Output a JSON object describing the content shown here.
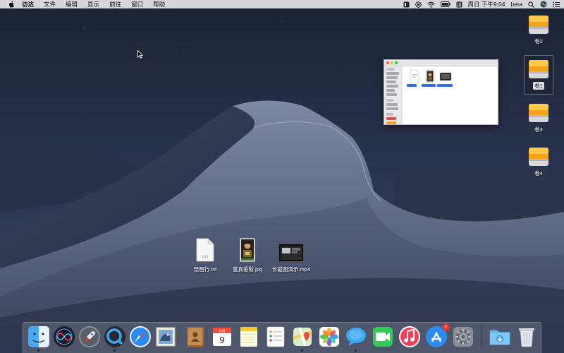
{
  "menubar": {
    "app_name": "访达",
    "items": [
      "文件",
      "编辑",
      "显示",
      "前往",
      "窗口",
      "帮助"
    ],
    "clock": "周日 下午9:04",
    "user": "beta"
  },
  "drives": [
    {
      "label": "卷2",
      "selected": false
    },
    {
      "label": "卷1",
      "selected": true
    },
    {
      "label": "卷3",
      "selected": false
    },
    {
      "label": "卷4",
      "selected": false
    }
  ],
  "desktop_files": [
    {
      "name": "琵琶行.txt",
      "type": "txt"
    },
    {
      "name": "童真垂髫.jpg",
      "type": "jpg"
    },
    {
      "name": "长截图演示.mp4",
      "type": "mp4"
    }
  ],
  "doc_icon_text": "TXT",
  "dock": {
    "apps": [
      "finder",
      "siri",
      "launchpad",
      "quicktime",
      "safari",
      "mail",
      "contacts",
      "calendar",
      "notes",
      "reminders",
      "maps",
      "photos",
      "messages",
      "facetime",
      "music",
      "app-store",
      "system-preferences"
    ],
    "calendar_month": "6月",
    "calendar_day": "9",
    "app_store_badge": "2",
    "accent_colors": {
      "finder": "#4aa8f0",
      "safari": "#2a8cf0",
      "music": "#f0405a",
      "facetime": "#34c759"
    }
  }
}
